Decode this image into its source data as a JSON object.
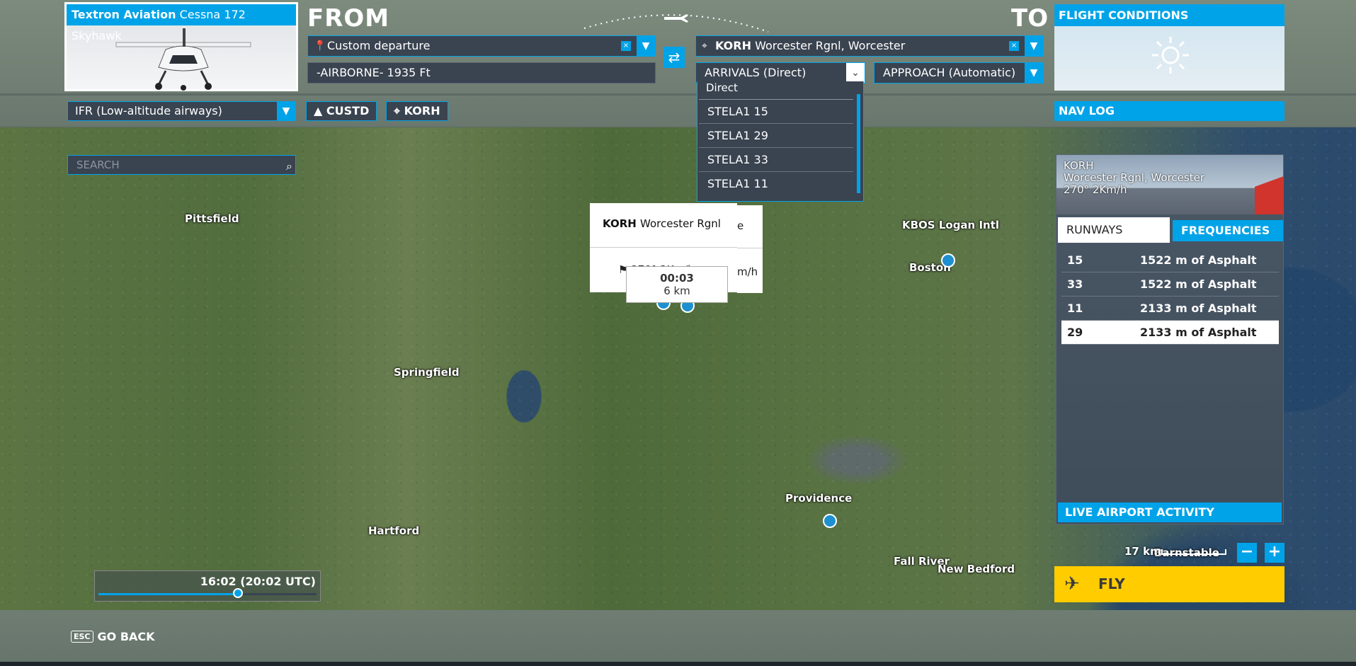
{
  "aircraft": {
    "brand": "Textron Aviation",
    "model": "Cessna 172 Skyhawk"
  },
  "route": {
    "from_label": "FROM",
    "to_label": "TO",
    "departure": "Custom departure",
    "altitude": "-AIRBORNE- 1935 Ft",
    "destination_code": "KORH",
    "destination_name": "Worcester Rgnl, Worcester",
    "arrivals": "ARRIVALS (Direct)",
    "approach": "APPROACH (Automatic)"
  },
  "arrivals_dropdown": {
    "items": [
      "Direct",
      "STELA1 15",
      "STELA1 29",
      "STELA1 33",
      "STELA1 11"
    ]
  },
  "flight_conditions": {
    "title": "FLIGHT CONDITIONS",
    "weather_icon": "sun-icon"
  },
  "nav": {
    "flight_type": "IFR (Low-altitude airways)",
    "from_chip": "CUSTD",
    "to_chip": "KORH",
    "nav_log": "NAV LOG"
  },
  "search": {
    "placeholder": "SEARCH"
  },
  "map": {
    "labels": [
      "Pittsfield",
      "Springfield",
      "Hartford",
      "KBOS Logan Intl",
      "Boston",
      "Providence",
      "Fall River",
      "New Bedford",
      "Barnstable"
    ],
    "popup": {
      "code": "KORH",
      "name": "Worcester Rgnl",
      "wind": "270° 2Km/h",
      "wind_tail": "m/h",
      "name_tail": "e"
    },
    "tooltip": {
      "time": "00:03",
      "distance": "6 km"
    }
  },
  "airport": {
    "code": "KORH",
    "name": "Worcester Rgnl, Worcester",
    "wind": "270° 2Km/h",
    "tabs": [
      "RUNWAYS",
      "FREQUENCIES"
    ],
    "runways": [
      {
        "number": "15",
        "desc": "1522 m of Asphalt"
      },
      {
        "number": "33",
        "desc": "1522 m of Asphalt"
      },
      {
        "number": "11",
        "desc": "2133 m of Asphalt"
      },
      {
        "number": "29",
        "desc": "2133 m of Asphalt"
      }
    ],
    "live_activity": "LIVE AIRPORT ACTIVITY"
  },
  "zoom": {
    "scale": "17 km",
    "minus": "−",
    "plus": "+"
  },
  "fly": {
    "label": "FLY"
  },
  "time": {
    "display": "16:02 (20:02 UTC)",
    "progress": 0.64
  },
  "footer": {
    "key": "ESC",
    "label": "GO BACK"
  },
  "colors": {
    "accent": "#00a3e8",
    "fly": "#ffcc00"
  }
}
